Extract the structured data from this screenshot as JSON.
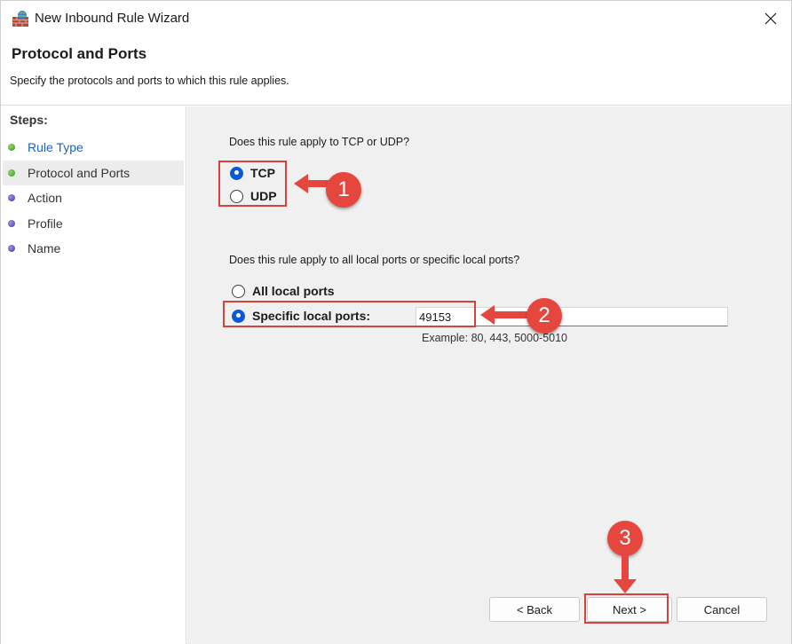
{
  "window": {
    "title": "New Inbound Rule Wizard"
  },
  "header": {
    "title": "Protocol and Ports",
    "subtitle": "Specify the protocols and ports to which this rule applies."
  },
  "steps": {
    "title": "Steps:",
    "items": [
      {
        "label": "Rule Type",
        "state": "done"
      },
      {
        "label": "Protocol and Ports",
        "state": "current"
      },
      {
        "label": "Action",
        "state": "pending"
      },
      {
        "label": "Profile",
        "state": "pending"
      },
      {
        "label": "Name",
        "state": "pending"
      }
    ]
  },
  "protocol": {
    "question": "Does this rule apply to TCP or UDP?",
    "options": [
      {
        "label": "TCP",
        "checked": true
      },
      {
        "label": "UDP",
        "checked": false
      }
    ]
  },
  "ports": {
    "question": "Does this rule apply to all local ports or specific local ports?",
    "options": [
      {
        "label": "All local ports",
        "checked": false
      },
      {
        "label": "Specific local ports:",
        "checked": true
      }
    ],
    "value": "49153",
    "example": "Example: 80, 443, 5000-5010"
  },
  "buttons": {
    "back": "< Back",
    "next": "Next >",
    "cancel": "Cancel"
  },
  "annotations": {
    "badges": [
      "1",
      "2",
      "3"
    ],
    "color": "#e5473f"
  },
  "colors": {
    "accent": "#0a5ad6",
    "link": "#1a63c4",
    "panel": "#f0f0f0"
  }
}
